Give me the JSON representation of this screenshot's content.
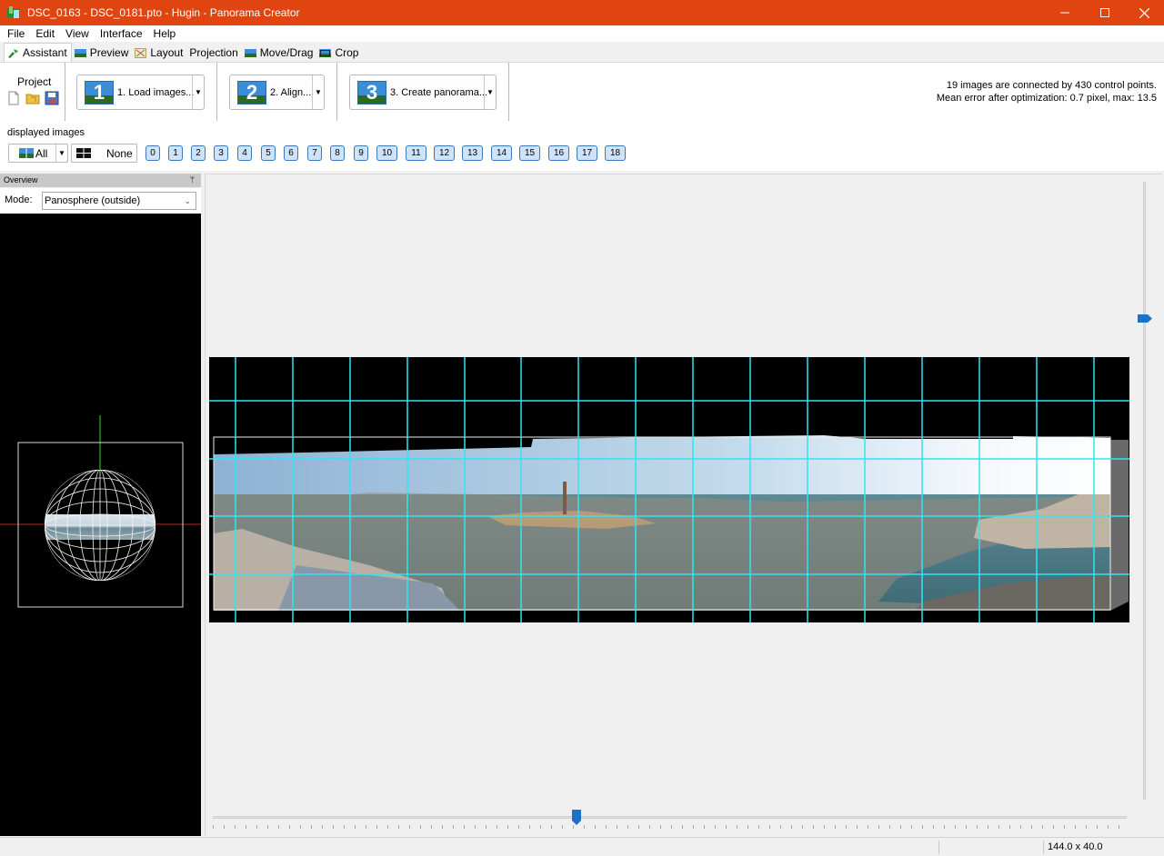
{
  "window": {
    "title": "DSC_0163 - DSC_0181.pto - Hugin - Panorama Creator",
    "controls": [
      "minimize-icon",
      "maximize-icon",
      "close-icon"
    ]
  },
  "menu": {
    "items": [
      "File",
      "Edit",
      "View",
      "Interface",
      "Help"
    ]
  },
  "tabs": [
    {
      "label": "Assistant",
      "icon": "wizard-icon",
      "active": true
    },
    {
      "label": "Preview",
      "icon": "preview-icon",
      "active": false
    },
    {
      "label": "Layout",
      "icon": "layout-icon",
      "active": false
    },
    {
      "label": "Projection",
      "icon": "",
      "active": false
    },
    {
      "label": "Move/Drag",
      "icon": "move-drag-icon",
      "active": false
    },
    {
      "label": "Crop",
      "icon": "crop-icon",
      "active": false
    }
  ],
  "assistant": {
    "project_label": "Project",
    "project_icons": [
      "new-project-icon",
      "open-project-icon",
      "save-project-icon"
    ],
    "steps": [
      {
        "number": "1",
        "label": "1. Load images..."
      },
      {
        "number": "2",
        "label": "2. Align..."
      },
      {
        "number": "3",
        "label": "3. Create panorama..."
      }
    ],
    "status_line1": "19 images are connected by 430 control points.",
    "status_line2": "Mean error after optimization: 0.7 pixel, max: 13.5"
  },
  "displayed_images": {
    "label": "displayed images",
    "all_label": "All",
    "none_label": "None",
    "buttons": [
      "0",
      "1",
      "2",
      "3",
      "4",
      "5",
      "6",
      "7",
      "8",
      "9",
      "10",
      "11",
      "12",
      "13",
      "14",
      "15",
      "16",
      "17",
      "18"
    ]
  },
  "overview": {
    "title": "Overview",
    "mode_label": "Mode:",
    "mode_value": "Panosphere (outside)"
  },
  "statusbar": {
    "fov": "144.0 x 40.0"
  },
  "colors": {
    "titlebar": "#e04410",
    "grid_line": "#2ee6f0",
    "accent": "#1a73c8",
    "image_button_fill": "#cfe3f8"
  }
}
